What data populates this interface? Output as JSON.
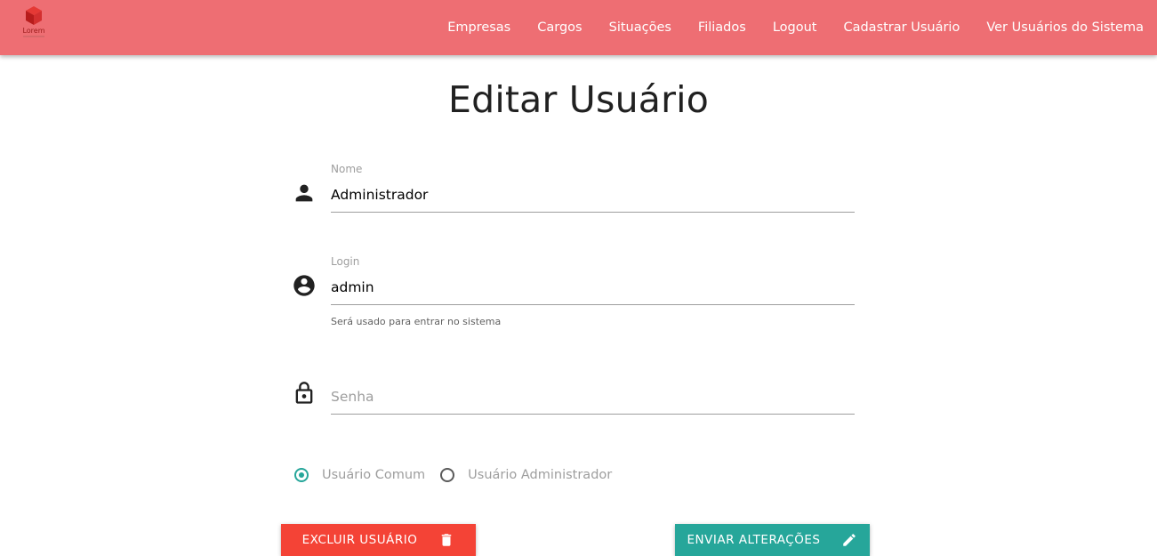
{
  "navbar": {
    "brand": "Lorem",
    "links": [
      "Empresas",
      "Cargos",
      "Situações",
      "Filiados",
      "Logout",
      "Cadastrar Usuário",
      "Ver Usuários do Sistema"
    ],
    "background": "#ee6e73"
  },
  "page": {
    "title": "Editar Usuário"
  },
  "form": {
    "nome": {
      "label": "Nome",
      "value": "Administrador",
      "icon": "person-icon"
    },
    "login": {
      "label": "Login",
      "value": "admin",
      "helper": "Será usado para entrar no sistema",
      "icon": "account-circle-icon"
    },
    "senha": {
      "placeholder": "Senha",
      "value": "",
      "icon": "lock-icon"
    },
    "tipo": {
      "options": [
        "Usuário Comum",
        "Usuário Administrador"
      ],
      "selected": "Usuário Comum"
    }
  },
  "actions": {
    "delete_label": "EXCLUIR USUÁRIO",
    "delete_icon": "trash-icon",
    "delete_color": "#f44336",
    "submit_label": "ENVIAR ALTERAÇÕES",
    "submit_icon": "pencil-icon",
    "submit_color": "#26a69a"
  }
}
